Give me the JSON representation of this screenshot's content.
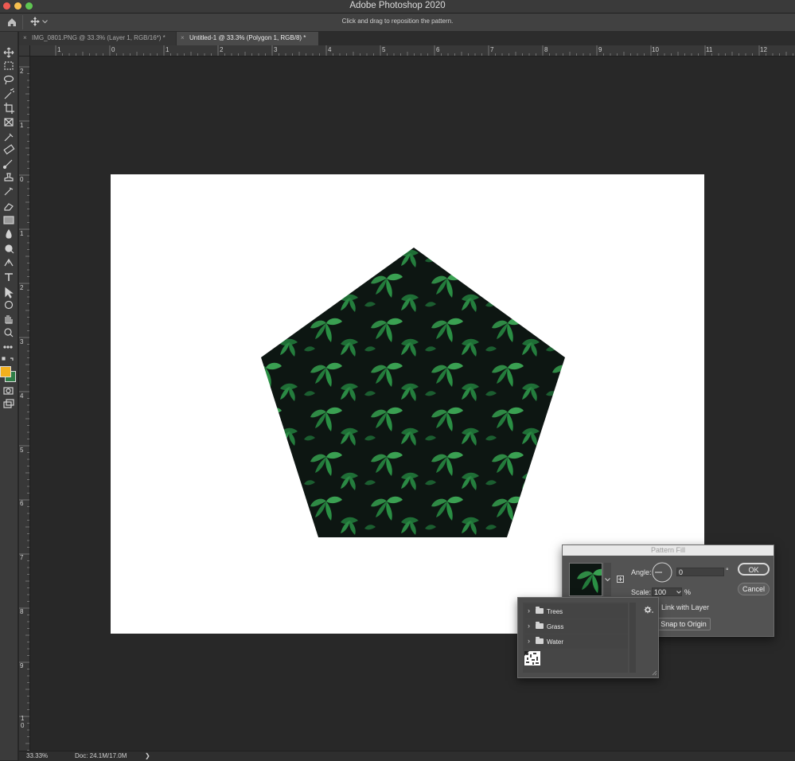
{
  "window": {
    "title": "Adobe Photoshop 2020"
  },
  "options_bar": {
    "hint": "Click and drag to reposition the pattern."
  },
  "tabs": [
    {
      "label": "IMG_0801.PNG @ 33.3% (Layer 1, RGB/16*) *",
      "close": "×",
      "active": false
    },
    {
      "label": "Untitled-1 @ 33.3% (Polygon 1, RGB/8) *",
      "close": "×",
      "active": true
    }
  ],
  "rulers": {
    "horizontal": [
      "1",
      "0",
      "1",
      "2",
      "3",
      "4",
      "5",
      "6",
      "7",
      "8",
      "9",
      "10",
      "11",
      "12"
    ],
    "vertical": [
      "2",
      "1",
      "0",
      "1",
      "2",
      "3",
      "4",
      "5",
      "6",
      "7",
      "8",
      "9",
      "1\n0"
    ]
  },
  "toolbar": {
    "tools": [
      "move-tool-icon",
      "marquee-tool-icon",
      "lasso-tool-icon",
      "magic-wand-icon",
      "crop-tool-icon",
      "frame-tool-icon",
      "eyedropper-icon",
      "healing-brush-icon",
      "brush-tool-icon",
      "clone-stamp-icon",
      "history-brush-icon",
      "eraser-icon",
      "gradient-tool-icon",
      "blur-tool-icon",
      "dodge-tool-icon",
      "pen-tool-icon",
      "type-tool-icon",
      "path-select-icon",
      "shape-tool-icon",
      "hand-tool-icon",
      "zoom-tool-icon",
      "more-tools-icon"
    ],
    "foreground_color": "#f2b01e",
    "background_color": "#2f7d46"
  },
  "pattern_fill": {
    "title": "Pattern Fill",
    "angle_label": "Angle:",
    "angle_value": "0",
    "degree_symbol": "°",
    "scale_label": "Scale:",
    "scale_value": "100",
    "percent_symbol": "%",
    "ok_label": "OK",
    "cancel_label": "Cancel",
    "link_with_layer_label": "Link with Layer",
    "snap_to_origin_label": "Snap to Origin"
  },
  "pattern_picker": {
    "folders": [
      "Trees",
      "Grass",
      "Water"
    ]
  },
  "status_bar": {
    "zoom": "33.33%",
    "doc_info": "Doc: 24.1M/17.0M",
    "arrow": "❯"
  },
  "colors": {
    "accent_leaf": "#2f8a45",
    "leaf_dark": "#0d1612"
  }
}
